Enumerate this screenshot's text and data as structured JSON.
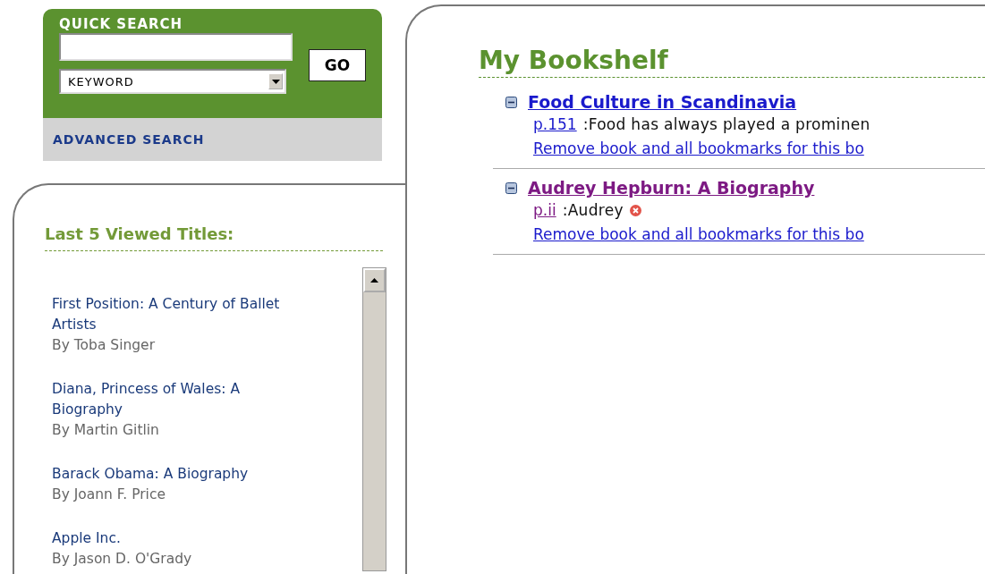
{
  "quick_search": {
    "title": "QUICK SEARCH",
    "search_type": {
      "value": "KEYWORD"
    },
    "go_button": "GO",
    "advanced_link": "ADVANCED SEARCH"
  },
  "recent": {
    "title": "Last 5 Viewed Titles:",
    "items": [
      {
        "title": "First Position: A Century of Ballet Artists",
        "author": "By Toba Singer"
      },
      {
        "title": "Diana, Princess of Wales: A Biography",
        "author": "By Martin Gitlin"
      },
      {
        "title": "Barack Obama: A Biography",
        "author": "By Joann F. Price"
      },
      {
        "title": "Apple Inc.",
        "author": "By Jason D. O'Grady"
      }
    ]
  },
  "bookshelf": {
    "title": "My Bookshelf",
    "books": [
      {
        "title": "Food Culture in Scandinavia",
        "expanded": true,
        "visited": false,
        "bookmarks": [
          {
            "page": "p.151",
            "visited": false,
            "note": ":Food has always played a prominen",
            "deletable": false
          }
        ],
        "remove_link": "Remove book and all bookmarks for this bo"
      },
      {
        "title": "Audrey Hepburn: A Biography",
        "expanded": true,
        "visited": true,
        "bookmarks": [
          {
            "page": "p.ii",
            "visited": true,
            "note": ":Audrey",
            "deletable": true
          }
        ],
        "remove_link": "Remove book and all bookmarks for this bo"
      }
    ]
  }
}
